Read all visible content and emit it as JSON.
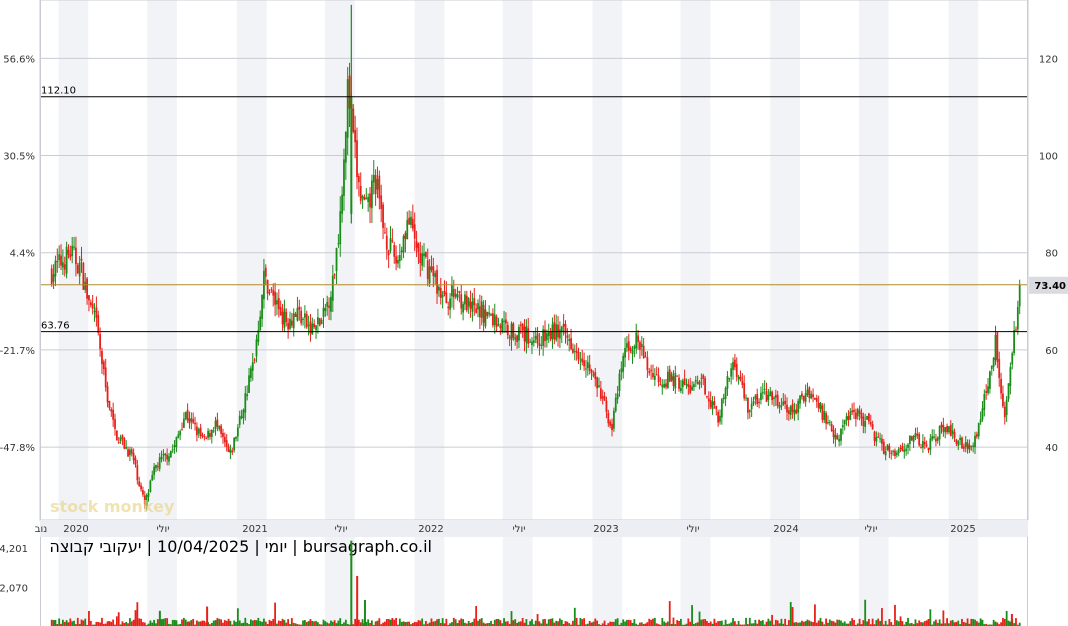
{
  "caption": "יומי | 10/04/2025 | יעקובי קבוצה | bursagraph.co.il",
  "watermark": "stock monkey",
  "colors": {
    "up": "#1a8c1a",
    "down": "#e8201a",
    "grid": "#c9ccd6",
    "band": "#f2f3f6",
    "level": "#000000",
    "last": "#b08a28"
  },
  "chart_data": [
    {
      "type": "line",
      "title": "",
      "x_ticks": [
        "נוב",
        "2020",
        "יולי",
        "2021",
        "יולי",
        "2022",
        "יולי",
        "2023",
        "יולי",
        "2024",
        "יולי",
        "2025"
      ],
      "y_right_ticks": [
        "120",
        "100",
        "80",
        "60",
        "40"
      ],
      "y_left_ticks": [
        "56.6%",
        "30.5%",
        "4.4%",
        "-21.7%",
        "-47.8%"
      ],
      "ylim": [
        25,
        132
      ],
      "levels": [
        {
          "label": "112.10",
          "value": 112.1
        },
        {
          "label": "63.76",
          "value": 63.76
        }
      ],
      "last_price": {
        "label": "73.40",
        "value": 73.4
      },
      "series": [
        {
          "x": [
            "2019-11-01",
            "2019-11-20",
            "2019-12-10",
            "2019-12-31",
            "2020-01-15",
            "2020-02-01",
            "2020-02-20",
            "2020-03-10",
            "2020-03-25",
            "2020-04-15",
            "2020-05-10",
            "2020-06-01",
            "2020-06-20",
            "2020-07-10",
            "2020-08-01",
            "2020-08-20",
            "2020-09-10",
            "2020-10-01",
            "2020-11-01",
            "2020-11-25",
            "2020-12-20",
            "2021-01-10",
            "2021-02-01",
            "2021-02-25",
            "2021-03-20",
            "2021-04-15",
            "2021-05-10",
            "2021-06-01",
            "2021-06-15",
            "2021-07-01",
            "2021-07-10",
            "2021-07-25",
            "2021-08-10",
            "2021-08-25",
            "2021-09-10",
            "2021-09-25",
            "2021-10-10",
            "2021-11-01",
            "2021-11-25",
            "2021-12-20",
            "2022-01-15",
            "2022-02-10",
            "2022-03-10",
            "2022-04-01",
            "2022-05-01",
            "2022-06-01",
            "2022-07-01",
            "2022-08-01",
            "2022-09-01",
            "2022-10-01",
            "2022-11-01",
            "2022-12-01",
            "2022-12-25",
            "2023-01-20",
            "2023-02-15",
            "2023-03-10",
            "2023-04-01",
            "2023-05-01",
            "2023-06-01",
            "2023-07-01",
            "2023-08-01",
            "2023-09-01",
            "2023-10-01",
            "2023-11-01",
            "2023-12-01",
            "2024-01-01",
            "2024-02-01",
            "2024-03-01",
            "2024-04-01",
            "2024-05-01",
            "2024-06-01",
            "2024-07-01",
            "2024-08-01",
            "2024-09-01",
            "2024-10-01",
            "2024-11-01",
            "2024-12-01",
            "2024-12-20",
            "2025-01-10",
            "2025-02-01",
            "2025-02-20",
            "2025-03-10",
            "2025-03-25",
            "2025-04-10"
          ],
          "values": [
            76,
            78,
            80,
            77,
            70,
            65,
            52,
            43,
            41,
            38,
            28,
            36,
            38,
            40,
            47,
            44,
            41,
            45,
            38,
            47,
            58,
            75,
            70,
            66,
            68,
            64,
            66,
            74,
            88,
            114,
            105,
            92,
            88,
            96,
            86,
            81,
            78,
            87,
            79,
            76,
            70,
            72,
            68,
            68,
            66,
            64,
            63,
            62,
            64,
            62,
            58,
            51,
            44,
            60,
            62,
            56,
            54,
            54,
            52,
            53,
            46,
            58,
            48,
            51,
            49,
            47,
            52,
            47,
            42,
            48,
            45,
            40,
            39,
            42,
            40,
            44,
            42,
            40,
            42,
            52,
            62,
            46,
            58,
            73.4
          ]
        }
      ]
    },
    {
      "type": "bar",
      "title": "",
      "y_ticks": [
        "4,201",
        "2,070"
      ],
      "ylim": [
        0,
        4800
      ]
    }
  ]
}
